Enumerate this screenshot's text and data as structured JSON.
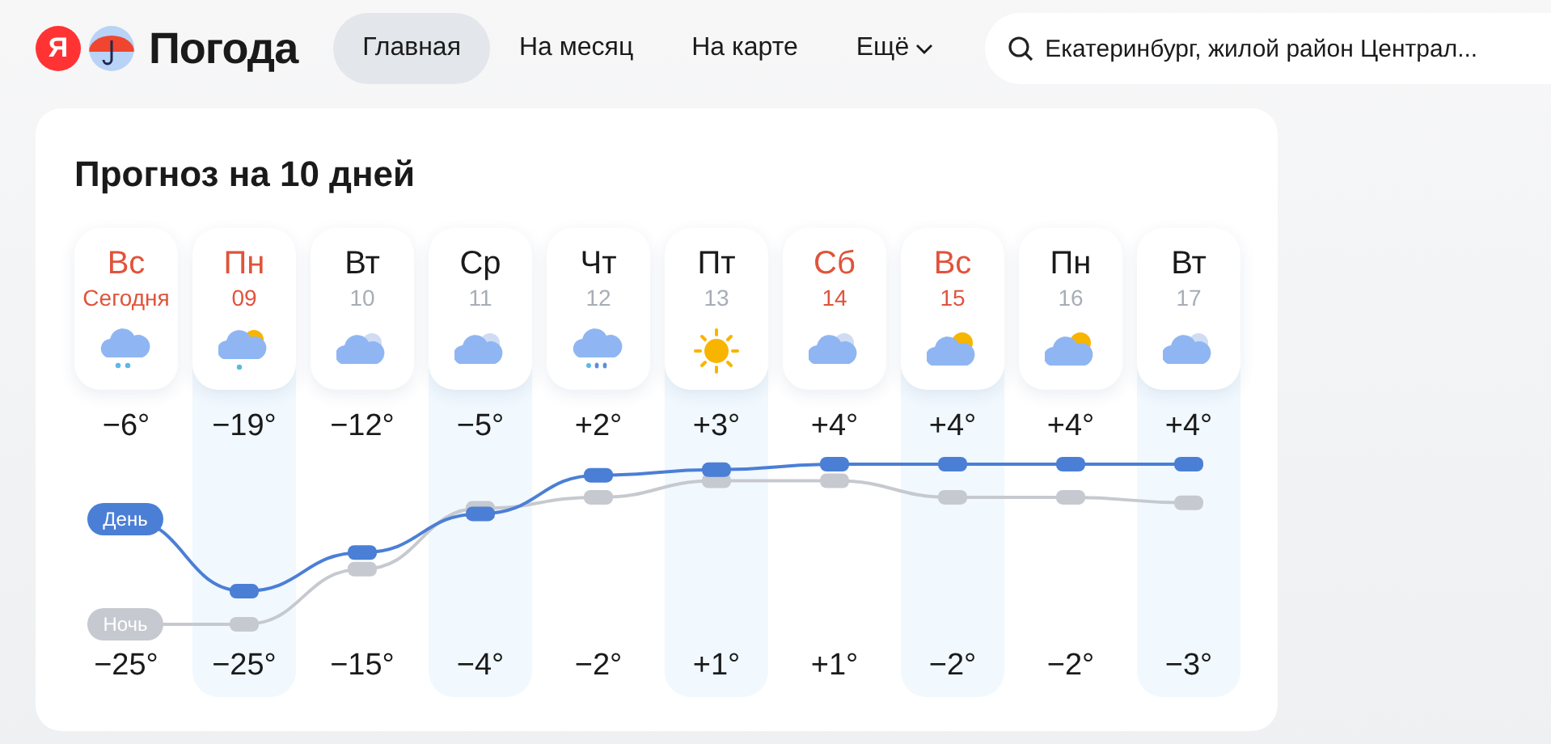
{
  "header": {
    "logo_letter": "Я",
    "brand": "Погода",
    "nav": [
      {
        "label": "Главная",
        "selected": true
      },
      {
        "label": "На месяц",
        "selected": false
      },
      {
        "label": "На карте",
        "selected": false
      },
      {
        "label": "Ещё",
        "selected": false,
        "kind": "dropdown"
      }
    ],
    "search": {
      "value": "Екатеринбург, жилой район Централ..."
    }
  },
  "forecast": {
    "title": "Прогноз на 10 дней",
    "days": [
      {
        "name": "Вс",
        "date": "Сегодня",
        "weekend": true,
        "kind": "snow-cloud",
        "day_temp": "−6°",
        "night_temp": "−25°"
      },
      {
        "name": "Пн",
        "date": "09",
        "weekend": true,
        "kind": "sun-cloud-snow",
        "day_temp": "−19°",
        "night_temp": "−25°"
      },
      {
        "name": "Вт",
        "date": "10",
        "weekend": false,
        "kind": "cloudy",
        "day_temp": "−12°",
        "night_temp": "−15°"
      },
      {
        "name": "Ср",
        "date": "11",
        "weekend": false,
        "kind": "cloudy",
        "day_temp": "−5°",
        "night_temp": "−4°"
      },
      {
        "name": "Чт",
        "date": "12",
        "weekend": false,
        "kind": "sleet-cloud",
        "day_temp": "+2°",
        "night_temp": "−2°"
      },
      {
        "name": "Пт",
        "date": "13",
        "weekend": false,
        "kind": "sun",
        "day_temp": "+3°",
        "night_temp": "+1°"
      },
      {
        "name": "Сб",
        "date": "14",
        "weekend": true,
        "kind": "cloudy",
        "day_temp": "+4°",
        "night_temp": "+1°"
      },
      {
        "name": "Вс",
        "date": "15",
        "weekend": true,
        "kind": "sun-cloud",
        "day_temp": "+4°",
        "night_temp": "−2°"
      },
      {
        "name": "Пн",
        "date": "16",
        "weekend": false,
        "kind": "sun-cloud",
        "day_temp": "+4°",
        "night_temp": "−2°"
      },
      {
        "name": "Вт",
        "date": "17",
        "weekend": false,
        "kind": "cloudy",
        "day_temp": "+4°",
        "night_temp": "−3°"
      }
    ],
    "graph_legend": [
      {
        "label": "День",
        "color": "#4b7fd6"
      },
      {
        "label": "Ночь",
        "color": "#c6c9cf"
      }
    ]
  }
}
